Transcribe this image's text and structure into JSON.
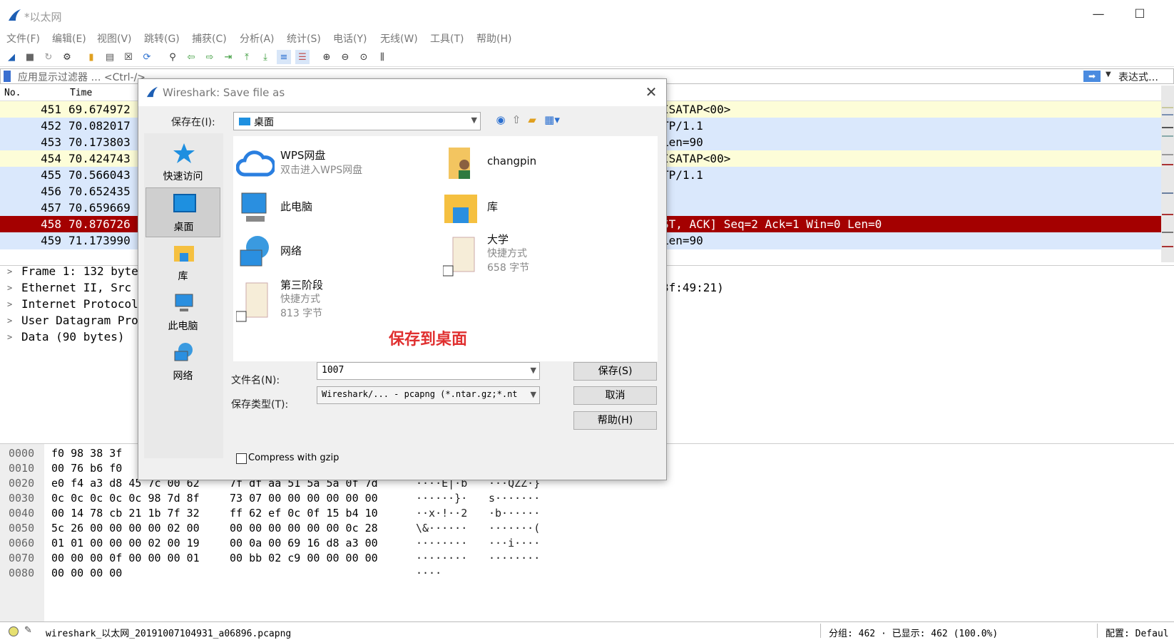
{
  "window": {
    "title": "*以太网",
    "minimize": "—",
    "maximize": "☐",
    "close": "✕"
  },
  "menu": [
    "文件(F)",
    "编辑(E)",
    "视图(V)",
    "跳转(G)",
    "捕获(C)",
    "分析(A)",
    "统计(S)",
    "电话(Y)",
    "无线(W)",
    "工具(T)",
    "帮助(H)"
  ],
  "filter": {
    "placeholder": "应用显示过滤器 … <Ctrl-/>",
    "expression": "表达式…"
  },
  "packet_list": {
    "headers": {
      "no": "No.",
      "time": "Time"
    },
    "rows": [
      {
        "no": "451",
        "time": "69.674972",
        "info": "ISATAP<00>",
        "style": "yellow"
      },
      {
        "no": "452",
        "time": "70.082017",
        "info": "TP/1.1",
        "style": "blue"
      },
      {
        "no": "453",
        "time": "70.173803",
        "info": "Len=90",
        "style": "blue"
      },
      {
        "no": "454",
        "time": "70.424743",
        "info": "ISATAP<00>",
        "style": "yellow"
      },
      {
        "no": "455",
        "time": "70.566043",
        "info": "TP/1.1",
        "style": "blue"
      },
      {
        "no": "456",
        "time": "70.652435",
        "info": "",
        "style": "blue"
      },
      {
        "no": "457",
        "time": "70.659669",
        "info": "",
        "style": "blue"
      },
      {
        "no": "458",
        "time": "70.876726",
        "info": "ST, ACK] Seq=2 Ack=1 Win=0 Len=0",
        "style": "red"
      },
      {
        "no": "459",
        "time": "71.173990",
        "info": "Len=90",
        "style": "blue"
      }
    ]
  },
  "details": [
    {
      "text": "Frame 1: 132 byte",
      "right": ""
    },
    {
      "text": "Ethernet II, Src",
      "right": "3f:49:21)"
    },
    {
      "text": "Internet Protocol",
      "right": ""
    },
    {
      "text": "User Datagram Pro",
      "right": ""
    },
    {
      "text": "Data (90 bytes)",
      "right": ""
    }
  ],
  "hex": [
    {
      "off": "0000",
      "b1": "f0 98 38 3f",
      "b2": "",
      "a1": "",
      "a2": ""
    },
    {
      "off": "0010",
      "b1": "00 76 b6 f0",
      "b2": "",
      "a1": "",
      "a2": ""
    },
    {
      "off": "0020",
      "b1": "e0 f4 a3 d8 45 7c 00 62",
      "b2": "7f df aa 51 5a 5a 0f 7d",
      "a1": "····E|·b",
      "a2": "···QZZ·}"
    },
    {
      "off": "0030",
      "b1": "0c 0c 0c 0c 0c 98 7d 8f",
      "b2": "73 07 00 00 00 00 00 00",
      "a1": "······}·",
      "a2": "s·······"
    },
    {
      "off": "0040",
      "b1": "00 14 78 cb 21 1b 7f 32",
      "b2": "ff 62 ef 0c 0f 15 b4 10",
      "a1": "··x·!··2",
      "a2": "·b······"
    },
    {
      "off": "0050",
      "b1": "5c 26 00 00 00 00 02 00",
      "b2": "00 00 00 00 00 00 0c 28",
      "a1": "\\&······",
      "a2": "·······("
    },
    {
      "off": "0060",
      "b1": "01 01 00 00 00 02 00 19",
      "b2": "00 0a 00 69 16 d8 a3 00",
      "a1": "········",
      "a2": "···i····"
    },
    {
      "off": "0070",
      "b1": "00 00 00 0f 00 00 00 01",
      "b2": "00 bb 02 c9 00 00 00 00",
      "a1": "········",
      "a2": "········"
    },
    {
      "off": "0080",
      "b1": "00 00 00 00",
      "b2": "",
      "a1": "····",
      "a2": ""
    }
  ],
  "status": {
    "edit_icon": "✎",
    "file": "wireshark_以太网_20191007104931_a06896.pcapng",
    "stats": "分组: 462 · 已显示: 462 (100.0%)",
    "profile": "配置: Defaul"
  },
  "dialog": {
    "title": "Wireshark: Save file as",
    "save_in_label": "保存在(I):",
    "save_in_value": "桌面",
    "places": [
      "快速访问",
      "桌面",
      "库",
      "此电脑",
      "网络"
    ],
    "files": {
      "wps": {
        "name": "WPS网盘",
        "sub": "双击进入WPS网盘"
      },
      "changpin": {
        "name": "changpin"
      },
      "pc": {
        "name": "此电脑"
      },
      "lib": {
        "name": "库"
      },
      "net": {
        "name": "网络"
      },
      "daxue": {
        "name": "大学",
        "sub": "快捷方式",
        "size": "658 字节"
      },
      "stage3": {
        "name": "第三阶段",
        "sub": "快捷方式",
        "size": "813 字节"
      }
    },
    "annotation": "保存到桌面",
    "filename_label": "文件名(N):",
    "filename_value": "1007",
    "filetype_label": "保存类型(T):",
    "filetype_value": "Wireshark/... - pcapng (*.ntar.gz;*.nt",
    "save_btn": "保存(S)",
    "cancel_btn": "取消",
    "help_btn": "帮助(H)",
    "gzip_label": "Compress with gzip"
  },
  "colors": {
    "yellow_row": "#fdfdd8",
    "blue_row": "#dae8fc",
    "red_row": "#a40000",
    "accent": "#2a6fd0"
  }
}
